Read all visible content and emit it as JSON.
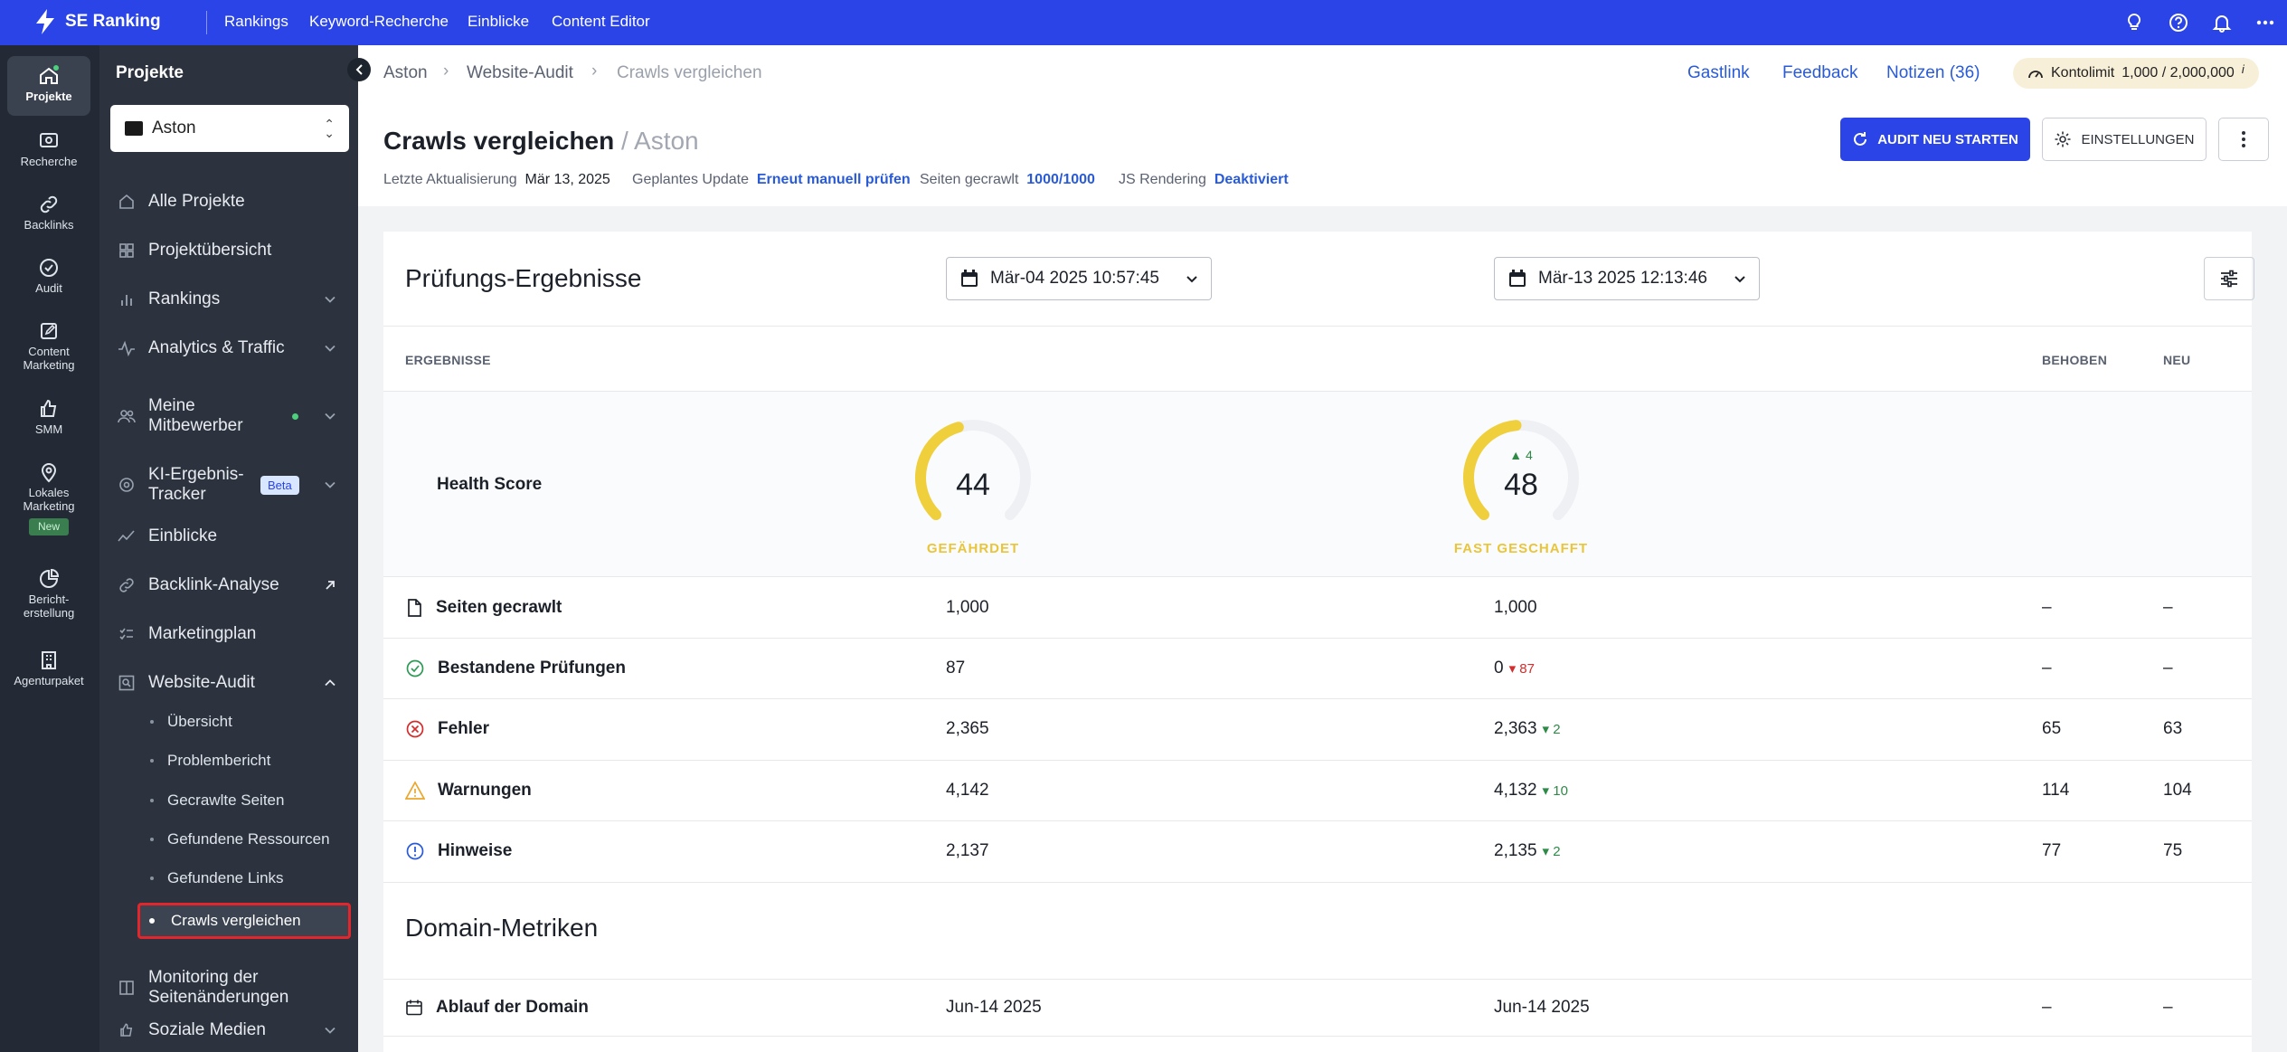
{
  "topbar": {
    "brand": "SE Ranking",
    "nav": [
      "Rankings",
      "Keyword-Recherche",
      "Einblicke",
      "Content Editor"
    ]
  },
  "rail": {
    "items": [
      {
        "label": "Projekte",
        "icon": "home-icon"
      },
      {
        "label": "Recherche",
        "icon": "research-icon"
      },
      {
        "label": "Backlinks",
        "icon": "link-icon"
      },
      {
        "label": "Audit",
        "icon": "check-circle-icon"
      },
      {
        "label": "Content Marketing",
        "icon": "edit-icon"
      },
      {
        "label": "SMM",
        "icon": "thumbs-up-icon"
      },
      {
        "label": "Lokales Marketing",
        "icon": "location-pin-icon",
        "badge": "New"
      },
      {
        "label": "Bericht-erstellung",
        "icon": "pie-chart-icon"
      },
      {
        "label": "Agenturpaket",
        "icon": "building-icon"
      }
    ]
  },
  "sidebar": {
    "title": "Projekte",
    "project": "Aston",
    "items": [
      {
        "label": "Alle Projekte"
      },
      {
        "label": "Projektübersicht"
      },
      {
        "label": "Rankings"
      },
      {
        "label": "Analytics & Traffic"
      },
      {
        "label": "Meine Mitbewerber"
      },
      {
        "label": "KI-Ergebnis-Tracker",
        "badge": "Beta"
      },
      {
        "label": "Einblicke"
      },
      {
        "label": "Backlink-Analyse"
      },
      {
        "label": "Marketingplan"
      },
      {
        "label": "Website-Audit"
      },
      {
        "label": "Monitoring der Seitenänderungen"
      },
      {
        "label": "Soziale Medien"
      }
    ],
    "sub_items": [
      "Übersicht",
      "Problembericht",
      "Gecrawlte Seiten",
      "Gefundene Ressourcen",
      "Gefundene Links",
      "Crawls vergleichen"
    ]
  },
  "header": {
    "breadcrumb": [
      "Aston",
      "Website-Audit",
      "Crawls vergleichen"
    ],
    "links": [
      "Gastlink",
      "Feedback",
      "Notizen (36)"
    ],
    "kontolimit_label": "Kontolimit",
    "kontolimit_value": "1,000 / 2,000,000",
    "title": "Crawls vergleichen",
    "title_project": "/ Aston",
    "meta": {
      "last_update_label": "Letzte Aktualisierung",
      "last_update_value": "Mär 13, 2025",
      "planned_label": "Geplantes Update",
      "planned_value": "Erneut manuell prüfen",
      "crawled_label": "Seiten gecrawlt",
      "crawled_value": "1000/1000",
      "js_label": "JS Rendering",
      "js_value": "Deaktiviert"
    },
    "restart_button": "AUDIT NEU STARTEN",
    "settings_button": "EINSTELLUNGEN"
  },
  "results": {
    "title": "Prüfungs-Ergebnisse",
    "date_a": "Mär-04 2025 10:57:45",
    "date_b": "Mär-13 2025 12:13:46",
    "columns": {
      "results": "ERGEBNISSE",
      "fixed": "BEHOBEN",
      "new": "NEU"
    },
    "health": {
      "label": "Health Score",
      "a": {
        "score": "44",
        "status": "GEFÄHRDET",
        "fraction": 0.44
      },
      "b": {
        "score": "48",
        "status": "FAST GESCHAFFT",
        "delta": "4",
        "fraction": 0.48
      }
    },
    "rows": [
      {
        "label": "Seiten gecrawlt",
        "icon": "document-icon",
        "a": "1,000",
        "b": "1,000",
        "delta": "",
        "dir": "",
        "fixed": "–",
        "new": "–"
      },
      {
        "label": "Bestandene Prüfungen",
        "icon": "check-circle-icon",
        "a": "87",
        "b": "0",
        "delta": "87",
        "dir": "down",
        "fixed": "–",
        "new": "–"
      },
      {
        "label": "Fehler",
        "icon": "error-icon",
        "a": "2,365",
        "b": "2,363",
        "delta": "2",
        "dir": "up",
        "fixed": "65",
        "new": "63"
      },
      {
        "label": "Warnungen",
        "icon": "warning-icon",
        "a": "4,142",
        "b": "4,132",
        "delta": "10",
        "dir": "up",
        "fixed": "114",
        "new": "104"
      },
      {
        "label": "Hinweise",
        "icon": "info-icon",
        "a": "2,137",
        "b": "2,135",
        "delta": "2",
        "dir": "up",
        "fixed": "77",
        "new": "75"
      }
    ]
  },
  "domain": {
    "title": "Domain-Metriken",
    "rows": [
      {
        "label": "Ablauf der Domain",
        "icon": "calendar-icon",
        "a": "Jun-14 2025",
        "b": "Jun-14 2025",
        "fixed": "–",
        "new": "–"
      }
    ]
  },
  "colors": {
    "accent": "#2a44e8",
    "gauge": "#f0cf3c",
    "ok": "#2e8a47",
    "bad": "#d32d2d"
  }
}
